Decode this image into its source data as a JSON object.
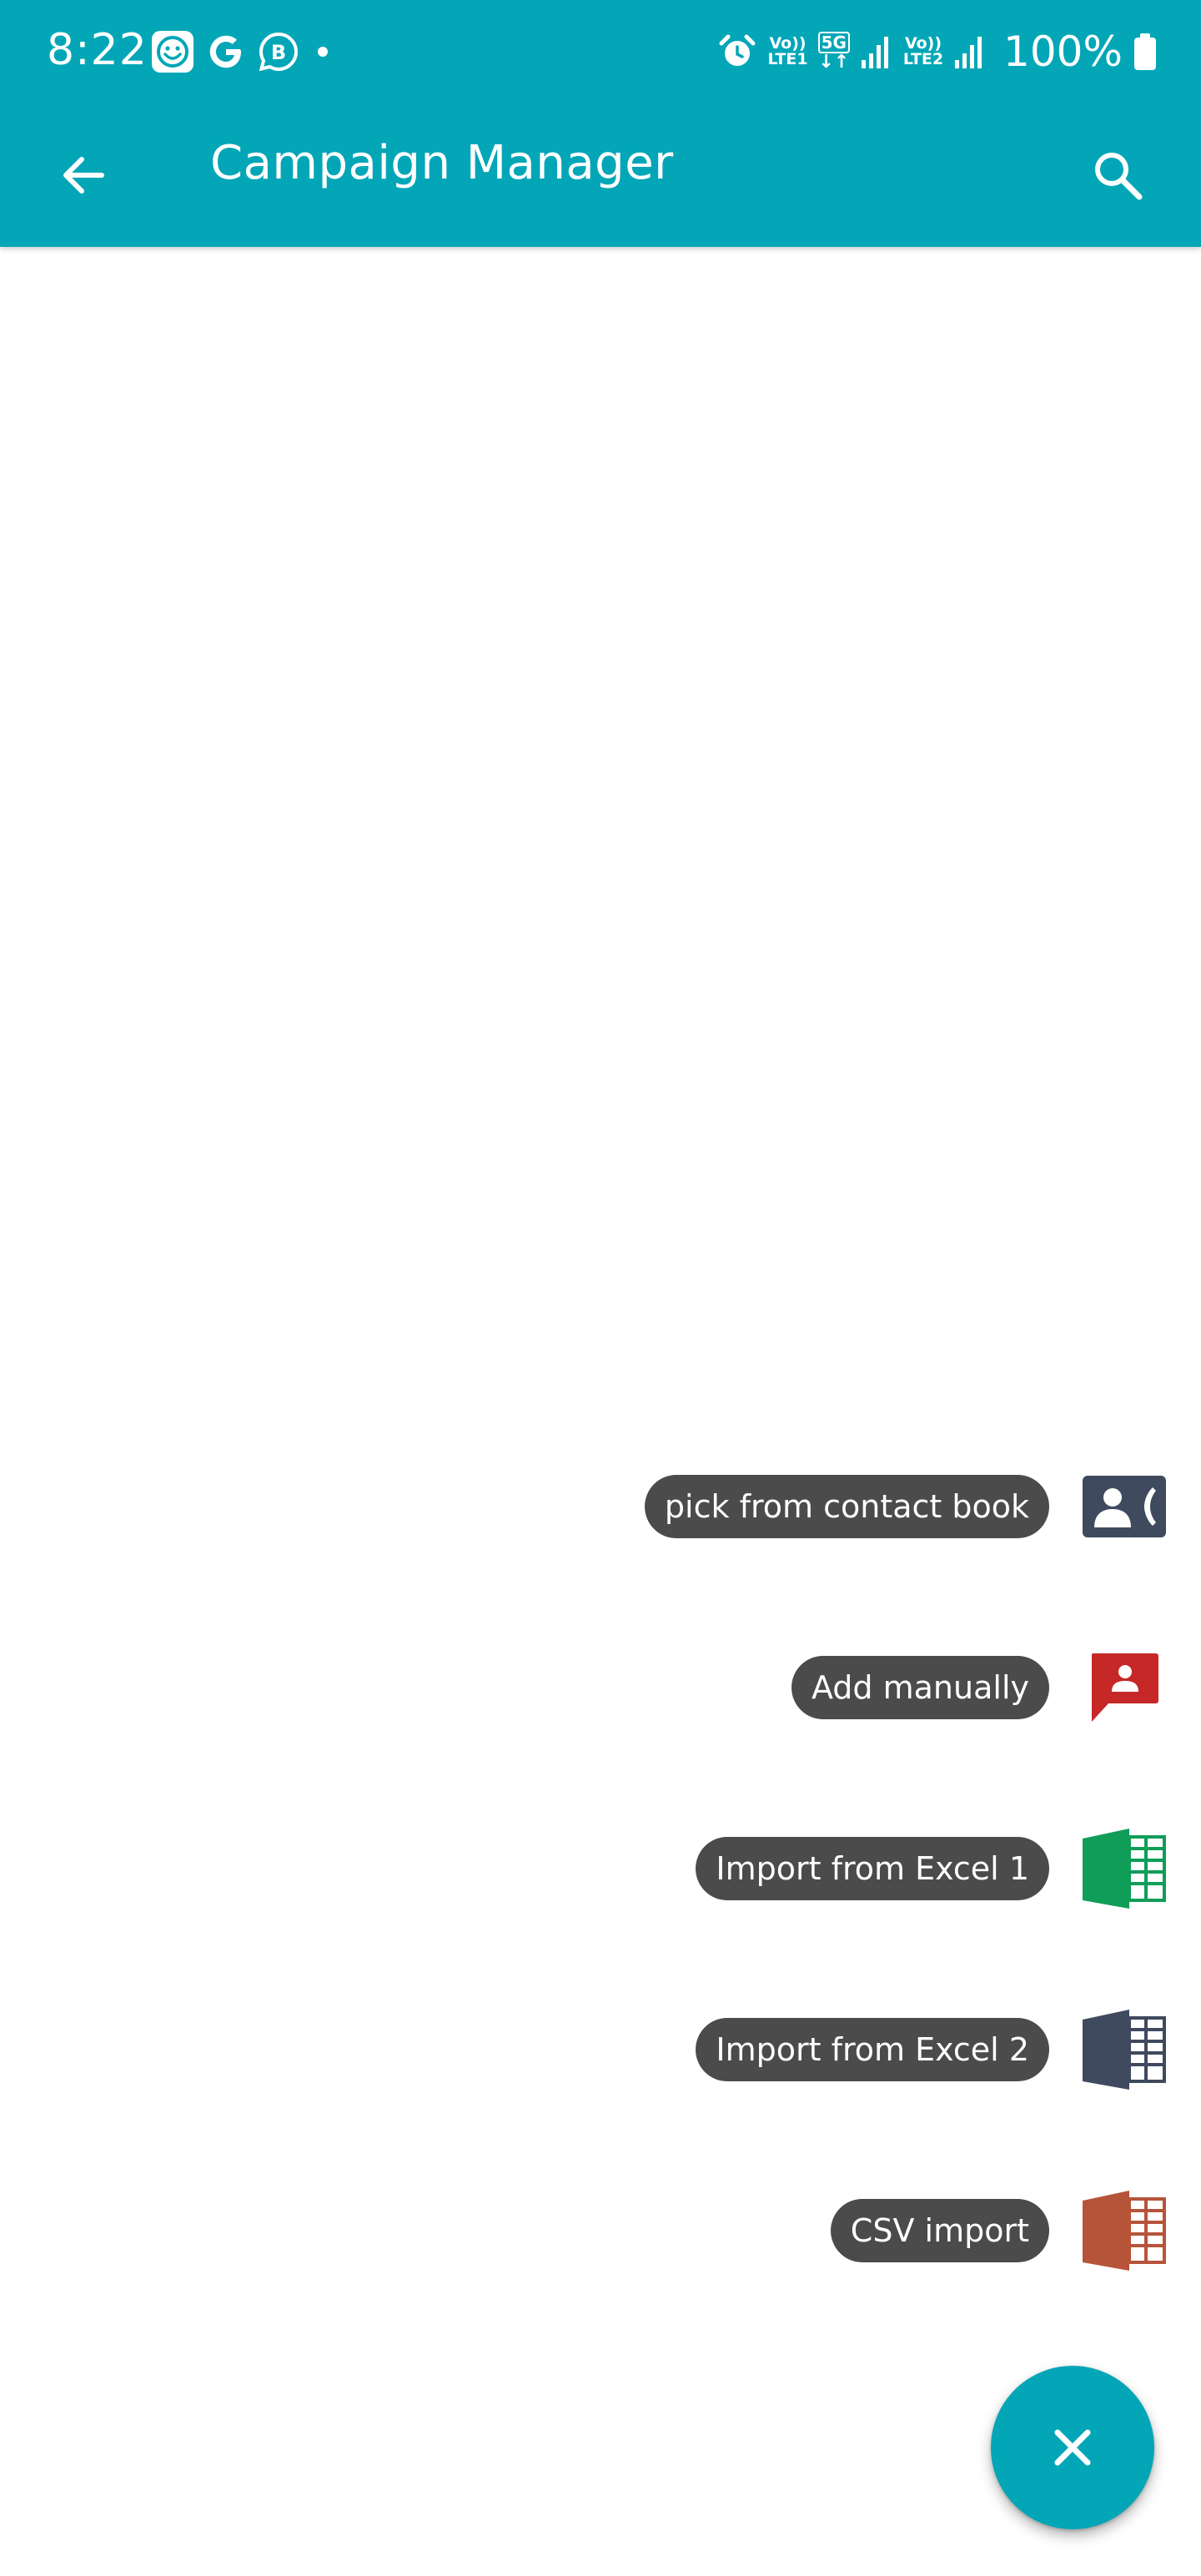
{
  "status_bar": {
    "time": "8:22",
    "left_icons": [
      "face-icon",
      "google-icon",
      "whatsapp-business-icon",
      "notification-dot-icon"
    ],
    "sim1_label_top": "Vo))",
    "sim1_label_bottom": "LTE1",
    "net_type": "5G",
    "sim2_label_top": "Vo))",
    "sim2_label_bottom": "LTE2",
    "battery": "100%"
  },
  "app_bar": {
    "title": "Campaign Manager",
    "back_icon": "arrow-back-icon",
    "search_icon": "search-icon"
  },
  "speed_dial": {
    "items": [
      {
        "label": "pick from contact book",
        "icon": "contact-phone-icon",
        "color": "#3F4A5E"
      },
      {
        "label": "Add manually",
        "icon": "contact-message-icon",
        "color": "#C62828"
      },
      {
        "label": "Import from Excel 1",
        "icon": "spreadsheet-icon",
        "color": "#0F9D58"
      },
      {
        "label": "Import from Excel 2",
        "icon": "spreadsheet-icon",
        "color": "#3F4A5E"
      },
      {
        "label": "CSV import",
        "icon": "spreadsheet-icon",
        "color": "#B6543A"
      }
    ]
  },
  "fab": {
    "icon": "close-icon"
  },
  "colors": {
    "primary": "#03A6B7",
    "chip_bg": "#4B4B4B",
    "background": "#FFFFFF"
  }
}
